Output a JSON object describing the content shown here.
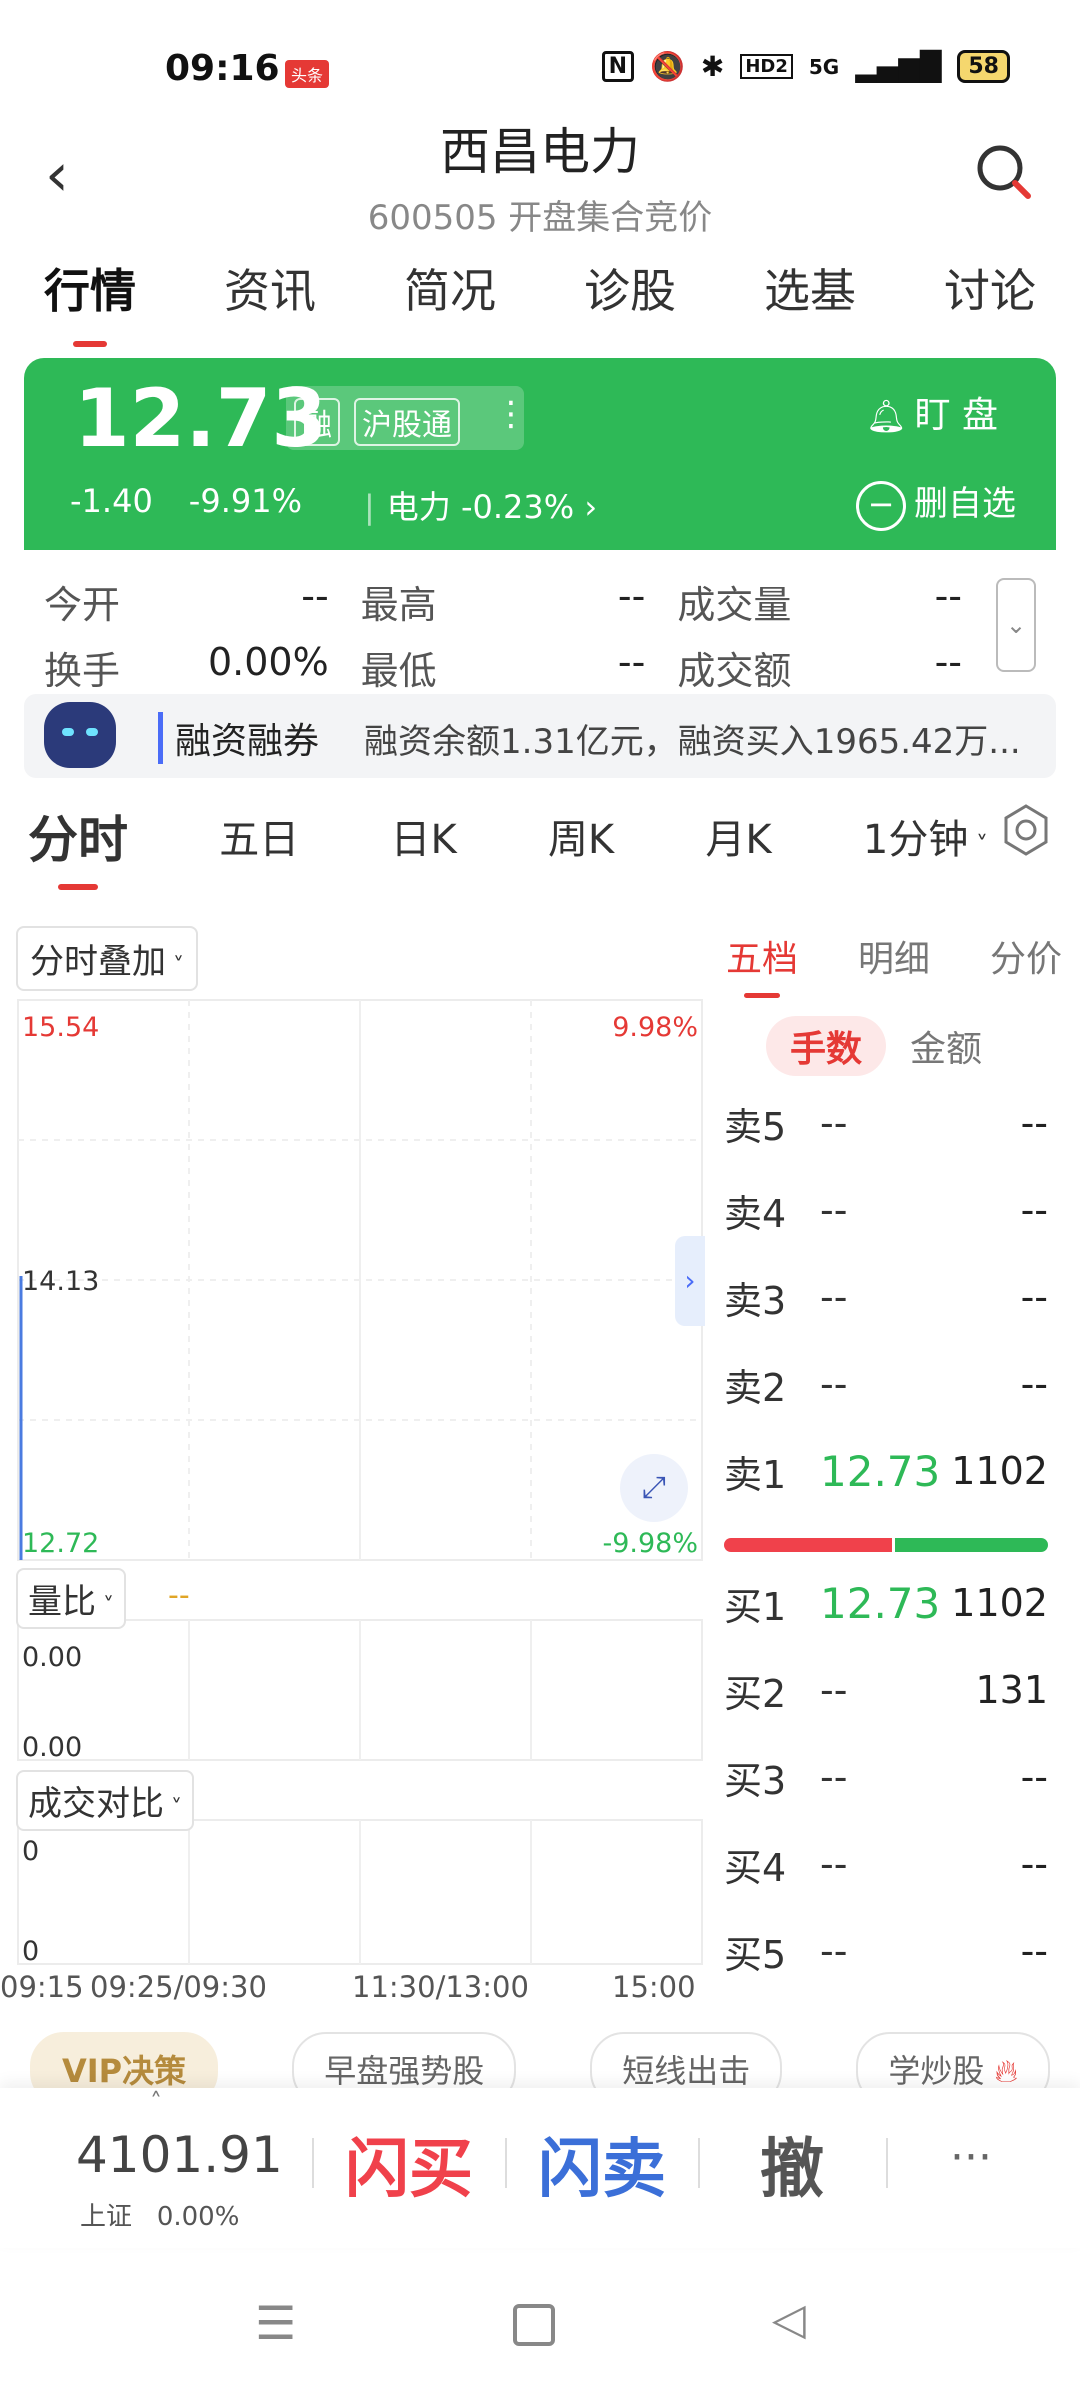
{
  "status_bar": {
    "time": "09:16",
    "badge": "头条",
    "nfc": "N",
    "hd": "HD2",
    "network": "5G",
    "battery": "58"
  },
  "header": {
    "title": "西昌电力",
    "subtitle": "600505 开盘集合竞价"
  },
  "tabs": [
    "行情",
    "资讯",
    "简况",
    "诊股",
    "选基",
    "讨论"
  ],
  "quote": {
    "price": "12.73",
    "tag_margin": "融",
    "tag_connect": "沪股通",
    "change": "-1.40",
    "change_pct": "-9.91%",
    "sector": "电力 -0.23%",
    "watch_label": "盯 盘",
    "remove_fav": "删自选"
  },
  "stats": [
    [
      {
        "label": "今开",
        "value": "--"
      },
      {
        "label": "最高",
        "value": "--"
      },
      {
        "label": "成交量",
        "value": "--"
      }
    ],
    [
      {
        "label": "换手",
        "value": "0.00%"
      },
      {
        "label": "最低",
        "value": "--"
      },
      {
        "label": "成交额",
        "value": "--"
      }
    ]
  ],
  "margin": {
    "label": "融资融券",
    "text": "融资余额1.31亿元，融资买入1965.42万..."
  },
  "chart_tabs": [
    "分时",
    "五日",
    "日K",
    "周K",
    "月K",
    "1分钟"
  ],
  "chart": {
    "overlay_label": "分时叠加",
    "ratio_label": "量比",
    "ratio_value": "--",
    "compare_label": "成交对比",
    "ob_tabs": [
      "五档",
      "明细",
      "分价"
    ],
    "unit_tabs": [
      "手数",
      "金额"
    ]
  },
  "chart_data": {
    "type": "line",
    "y_ticks": [
      "15.54",
      "14.13",
      "12.72"
    ],
    "pct_ticks": [
      "9.98%",
      "-9.98%"
    ],
    "ylim": [
      12.72,
      15.54
    ],
    "x_ticks": [
      "09:15",
      "09:25/09:30",
      "11:30/13:00",
      "15:00"
    ],
    "volume_ratio_ticks": [
      "0.00",
      "0.00"
    ],
    "compare_ticks": [
      "0",
      "0"
    ]
  },
  "order_book": {
    "asks": [
      {
        "label": "卖5",
        "price": "--",
        "qty": "--"
      },
      {
        "label": "卖4",
        "price": "--",
        "qty": "--"
      },
      {
        "label": "卖3",
        "price": "--",
        "qty": "--"
      },
      {
        "label": "卖2",
        "price": "--",
        "qty": "--"
      },
      {
        "label": "卖1",
        "price": "12.73",
        "qty": "1102"
      }
    ],
    "bids": [
      {
        "label": "买1",
        "price": "12.73",
        "qty": "1102"
      },
      {
        "label": "买2",
        "price": "--",
        "qty": "131"
      },
      {
        "label": "买3",
        "price": "--",
        "qty": "--"
      },
      {
        "label": "买4",
        "price": "--",
        "qty": "--"
      },
      {
        "label": "买5",
        "price": "--",
        "qty": "--"
      }
    ],
    "buy_ratio": 0.52
  },
  "pills": [
    "VIP决策",
    "早盘强势股",
    "短线出击",
    "学炒股"
  ],
  "bottom": {
    "index_value": "4101.91",
    "index_name": "上证",
    "index_pct": "0.00%",
    "buy": "闪买",
    "sell": "闪卖",
    "cancel": "撤",
    "more": "···"
  },
  "colors": {
    "up": "#e53935",
    "down": "#2eb957",
    "card": "#2eb957",
    "accent": "#4a6cf7"
  }
}
